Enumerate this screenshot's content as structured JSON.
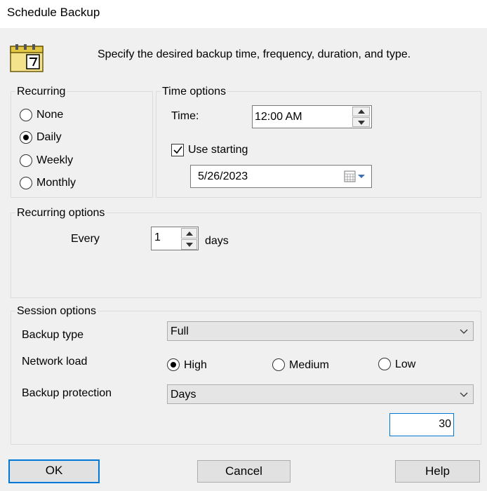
{
  "window": {
    "title": "Schedule Backup"
  },
  "header": {
    "instructions": "Specify the desired backup time, frequency, duration, and type.",
    "icon": "calendar-icon"
  },
  "recurring": {
    "group_label": "Recurring",
    "options": [
      {
        "label": "None",
        "checked": false
      },
      {
        "label": "Daily",
        "checked": true
      },
      {
        "label": "Weekly",
        "checked": false
      },
      {
        "label": "Monthly",
        "checked": false
      }
    ]
  },
  "time_options": {
    "group_label": "Time options",
    "time_label": "Time:",
    "time_value": "12:00 AM",
    "use_starting_label": "Use starting",
    "use_starting_checked": true,
    "date_value": "5/26/2023"
  },
  "recurring_options": {
    "group_label": "Recurring options",
    "every_label": "Every",
    "every_value": "1",
    "unit_label": "days"
  },
  "session_options": {
    "group_label": "Session options",
    "backup_type_label": "Backup type",
    "backup_type_value": "Full",
    "network_load_label": "Network load",
    "network_load_options": [
      {
        "label": "High",
        "checked": true
      },
      {
        "label": "Medium",
        "checked": false
      },
      {
        "label": "Low",
        "checked": false
      }
    ],
    "backup_protection_label": "Backup protection",
    "backup_protection_value": "Days",
    "protection_amount": "30"
  },
  "buttons": {
    "ok": "OK",
    "cancel": "Cancel",
    "help": "Help"
  },
  "colors": {
    "accent": "#0078d7",
    "background": "#f0f0f0"
  }
}
